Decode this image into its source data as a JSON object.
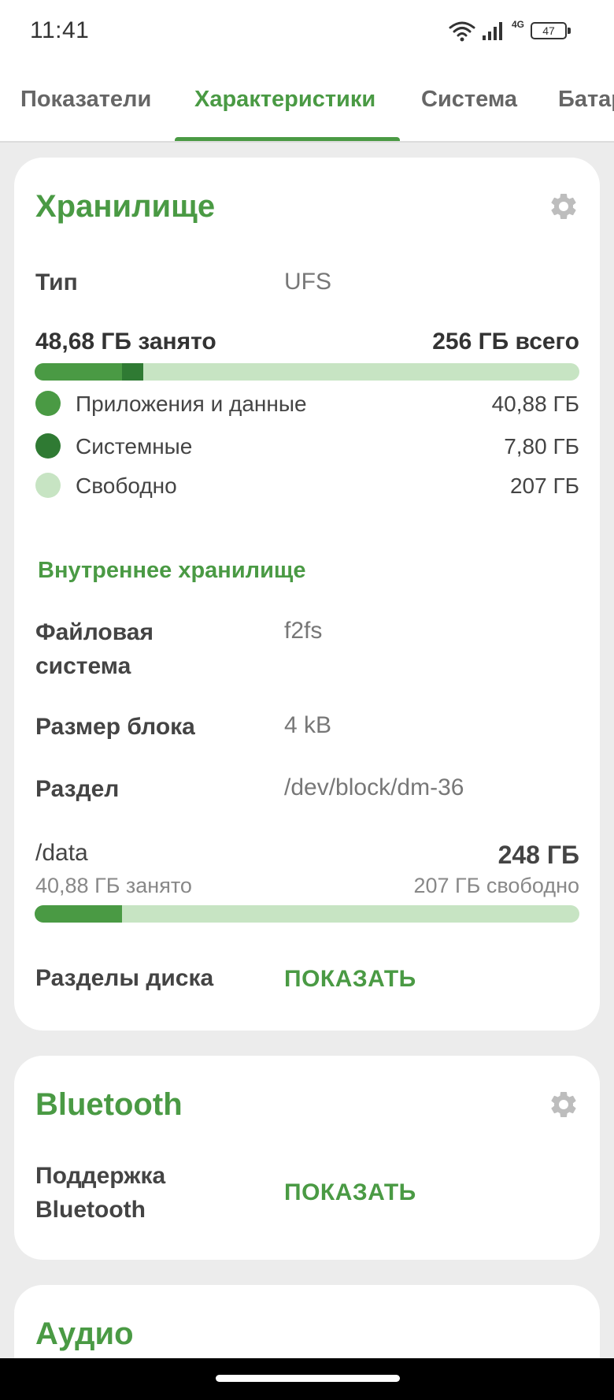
{
  "status_bar": {
    "time": "11:41",
    "network": "4G",
    "battery": "47"
  },
  "tabs": [
    {
      "label": "Показатели"
    },
    {
      "label": "Характеристики"
    },
    {
      "label": "Система"
    },
    {
      "label": "Батарея"
    }
  ],
  "active_tab": "Характеристики",
  "storage": {
    "title": "Хранилище",
    "type_label": "Тип",
    "type_value": "UFS",
    "used": "48,68 ГБ занято",
    "total": "256 ГБ всего",
    "usage_fraction": {
      "apps": 0.16,
      "system": 0.04
    },
    "legend": [
      {
        "label": "Приложения и данные",
        "value": "40,88 ГБ",
        "color": "#4a9a44"
      },
      {
        "label": "Системные",
        "value": "7,80 ГБ",
        "color": "#2f7a33"
      },
      {
        "label": "Свободно",
        "value": "207 ГБ",
        "color": "#c7e4c3"
      }
    ],
    "internal": {
      "title": "Внутреннее хранилище",
      "fs_label_line1": "Файловая",
      "fs_label_line2": "система",
      "fs_value": "f2fs",
      "block_label": "Размер блока",
      "block_value": "4 kB",
      "partition_label": "Раздел",
      "partition_value": "/dev/block/dm-36",
      "mount": "/data",
      "mount_size": "248 ГБ",
      "mount_used": "40,88 ГБ занято",
      "mount_free": "207 ГБ свободно",
      "mount_fraction": 0.16,
      "disks_label": "Разделы диска",
      "disks_action": "ПОКАЗАТЬ"
    }
  },
  "bluetooth": {
    "title": "Bluetooth",
    "support_label_line1": "Поддержка",
    "support_label_line2": "Bluetooth",
    "support_action": "ПОКАЗАТЬ"
  },
  "audio": {
    "title": "Аудио"
  },
  "colors": {
    "accent": "#4a9a44",
    "accent_dark": "#2f7a33",
    "accent_light": "#c7e4c3"
  }
}
